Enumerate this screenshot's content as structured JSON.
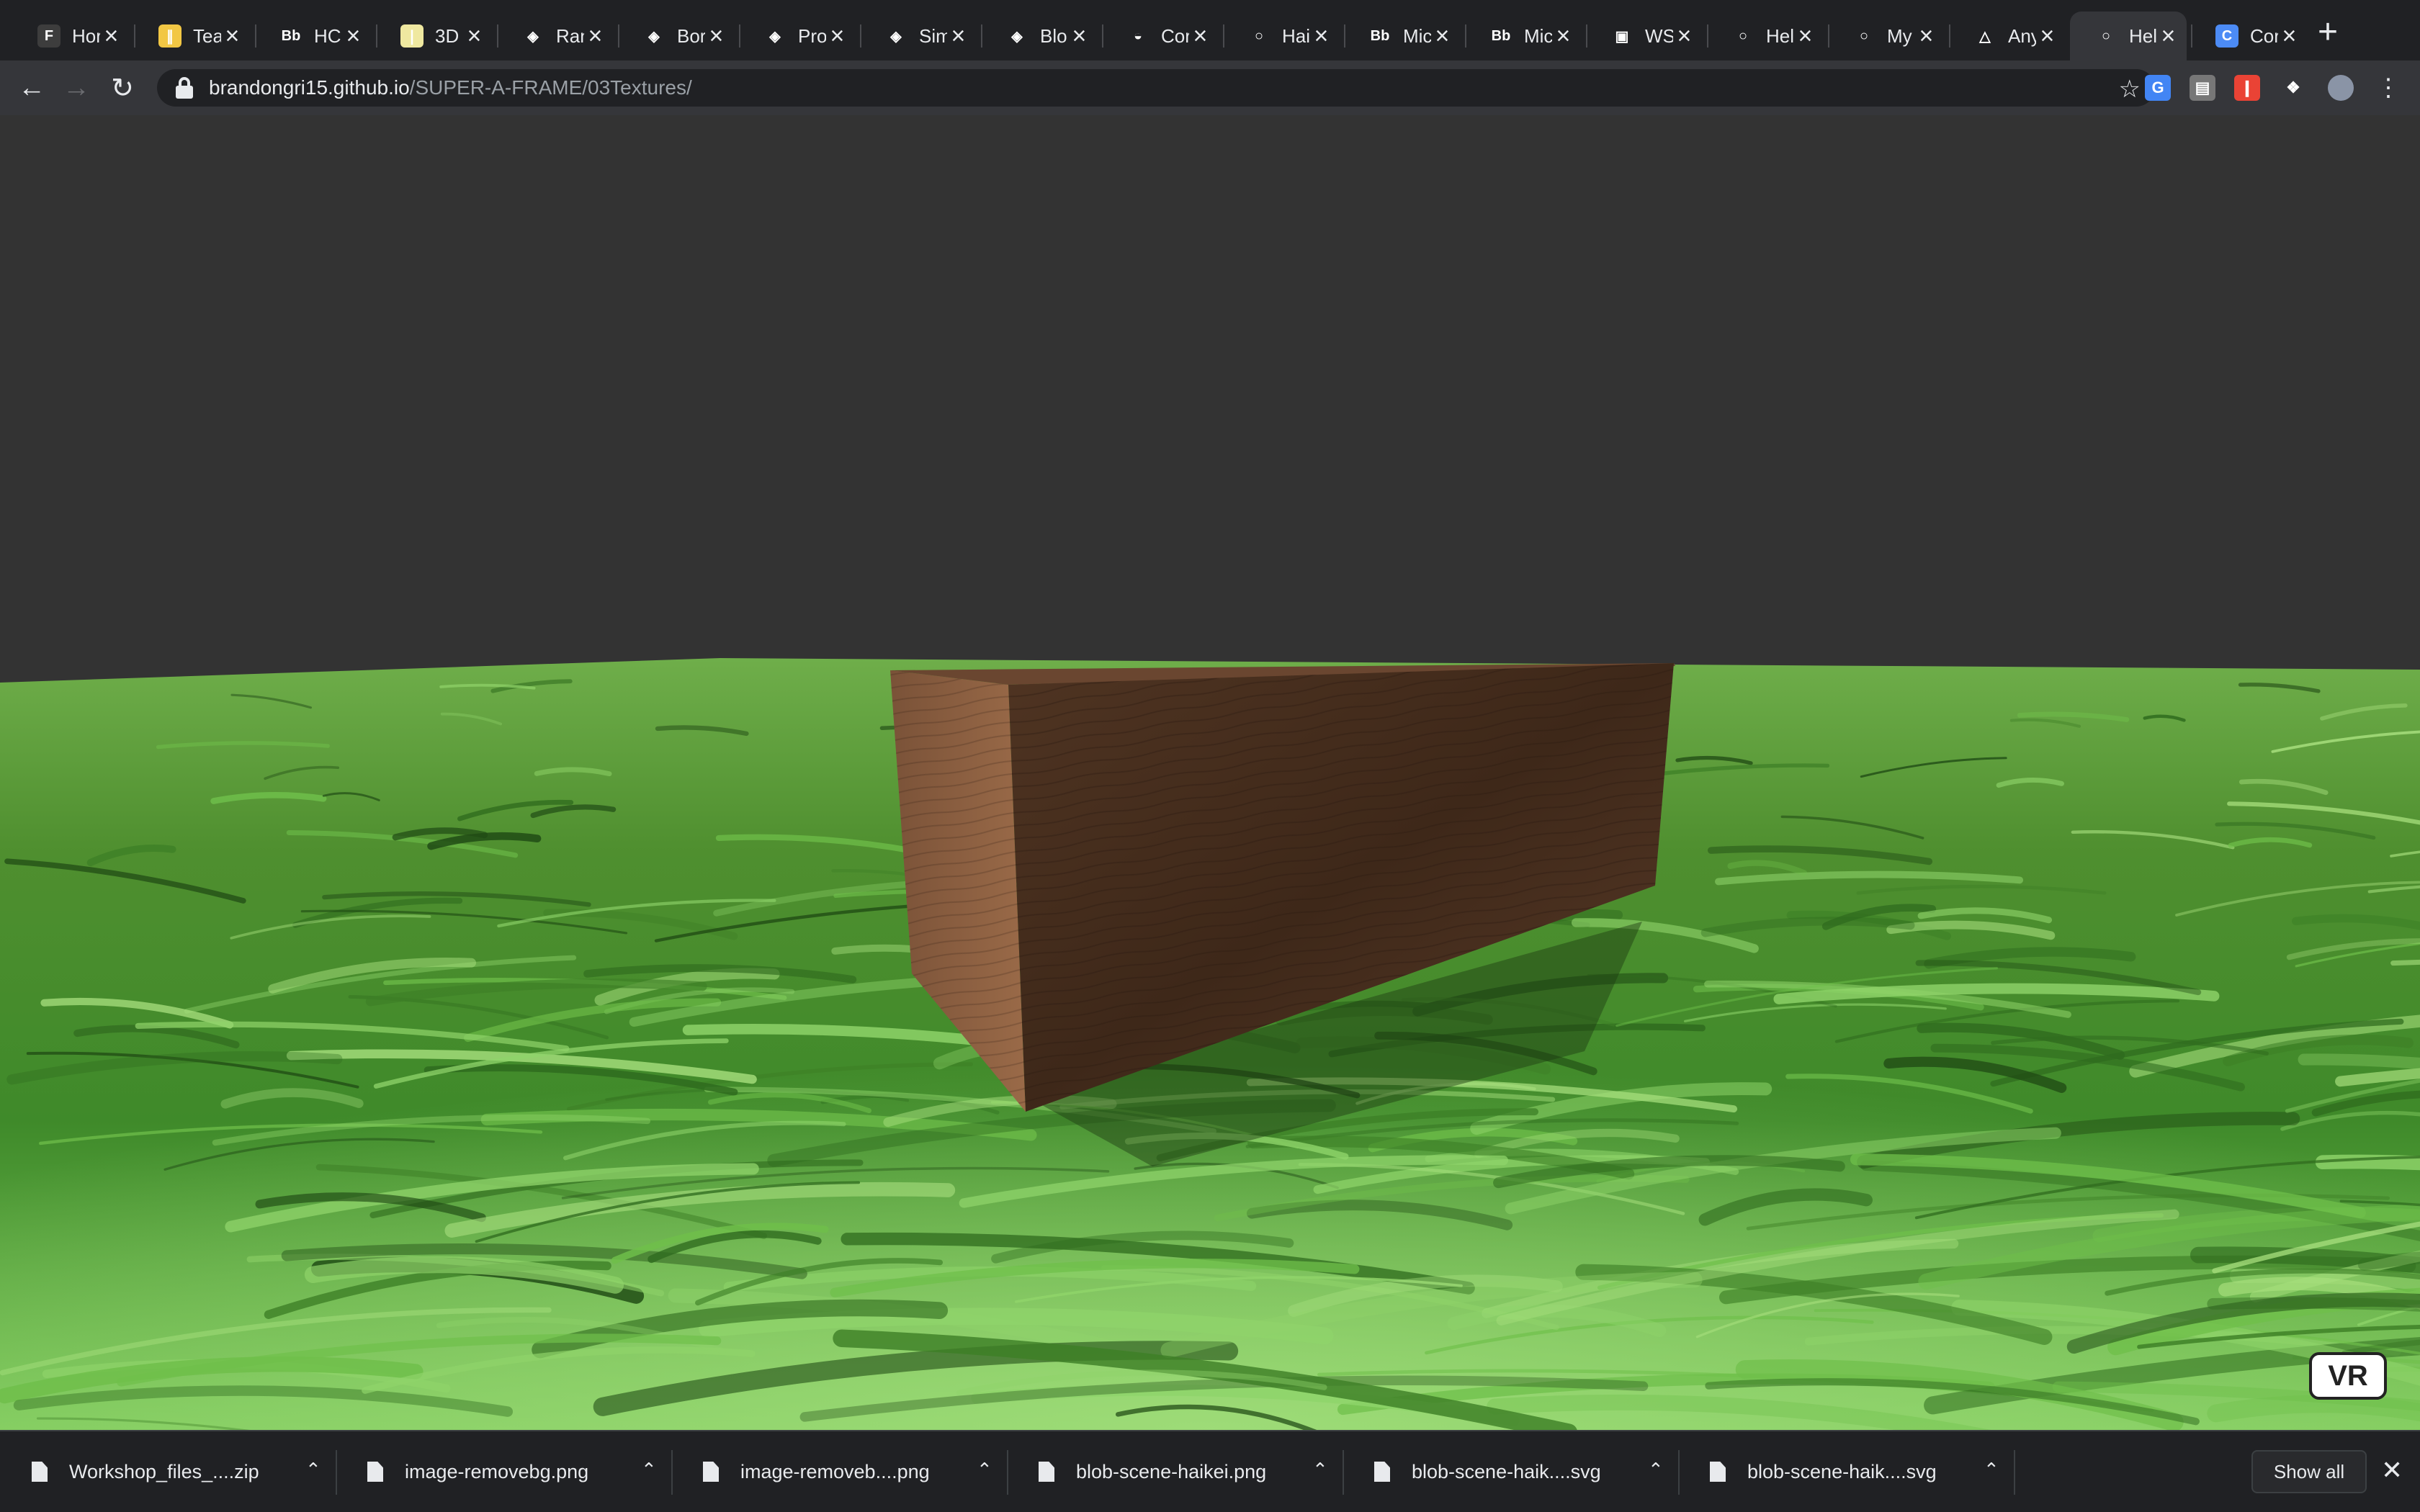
{
  "tabs": [
    {
      "title": "Hor",
      "icon": "figma-icon",
      "glyph": "F",
      "color": "#3d3d3d"
    },
    {
      "title": "Tea",
      "icon": "miro-icon",
      "glyph": "∥",
      "color": "#f2c744"
    },
    {
      "title": "HCI",
      "icon": "blackboard-icon",
      "glyph": "Bb",
      "color": "transparent"
    },
    {
      "title": "3D",
      "icon": "bamboo-icon",
      "glyph": "❘",
      "color": "#efe8a0"
    },
    {
      "title": "Ran",
      "icon": "webflow-icon",
      "glyph": "◈",
      "color": "transparent"
    },
    {
      "title": "Bor",
      "icon": "webflow-icon",
      "glyph": "◈",
      "color": "transparent"
    },
    {
      "title": "Pro",
      "icon": "webflow-icon",
      "glyph": "◈",
      "color": "transparent"
    },
    {
      "title": "Sim",
      "icon": "webflow-icon",
      "glyph": "◈",
      "color": "transparent"
    },
    {
      "title": "Blo",
      "icon": "webflow-icon",
      "glyph": "◈",
      "color": "transparent"
    },
    {
      "title": "Cor",
      "icon": "pokeball-icon",
      "glyph": "◒",
      "color": "transparent"
    },
    {
      "title": "Hai",
      "icon": "globe-icon",
      "glyph": "○",
      "color": "transparent"
    },
    {
      "title": "Mic",
      "icon": "blackboard-icon",
      "glyph": "Bb",
      "color": "transparent"
    },
    {
      "title": "Mic",
      "icon": "blackboard-icon",
      "glyph": "Bb",
      "color": "transparent"
    },
    {
      "title": "WS",
      "icon": "ws-icon",
      "glyph": "▣",
      "color": "transparent"
    },
    {
      "title": "Hel",
      "icon": "globe-icon",
      "glyph": "○",
      "color": "transparent"
    },
    {
      "title": "My",
      "icon": "globe-icon",
      "glyph": "○",
      "color": "transparent"
    },
    {
      "title": "Any",
      "icon": "airbnb-icon",
      "glyph": "△",
      "color": "transparent"
    },
    {
      "title": "Hel",
      "icon": "globe-icon",
      "glyph": "○",
      "color": "transparent",
      "active": true
    },
    {
      "title": "Cor",
      "icon": "c-icon",
      "glyph": "C",
      "color": "#4c8bf5"
    }
  ],
  "toolbar": {
    "url_host": "brandongri15.github.io",
    "url_path": "/SUPER-A-FRAME/03Textures/"
  },
  "extensions": [
    {
      "name": "translate-extension-icon",
      "glyph": "G",
      "color": "#4285f4"
    },
    {
      "name": "generic-extension-icon",
      "glyph": "▤",
      "color": "#777777"
    },
    {
      "name": "bars-extension-icon",
      "glyph": "❙",
      "color": "#ea4335"
    },
    {
      "name": "puzzle-extension-icon",
      "glyph": "❖",
      "color": "transparent"
    }
  ],
  "scene": {
    "sky_color": "#333333",
    "ground_color": "#5aa33a",
    "box_color": "#5a3b28",
    "vr_label": "VR"
  },
  "downloads": [
    {
      "name": "Workshop_files_....zip"
    },
    {
      "name": "image-removebg.png"
    },
    {
      "name": "image-removeb....png"
    },
    {
      "name": "blob-scene-haikei.png"
    },
    {
      "name": "blob-scene-haik....svg"
    },
    {
      "name": "blob-scene-haik....svg"
    }
  ],
  "shelf": {
    "show_all_label": "Show all"
  }
}
